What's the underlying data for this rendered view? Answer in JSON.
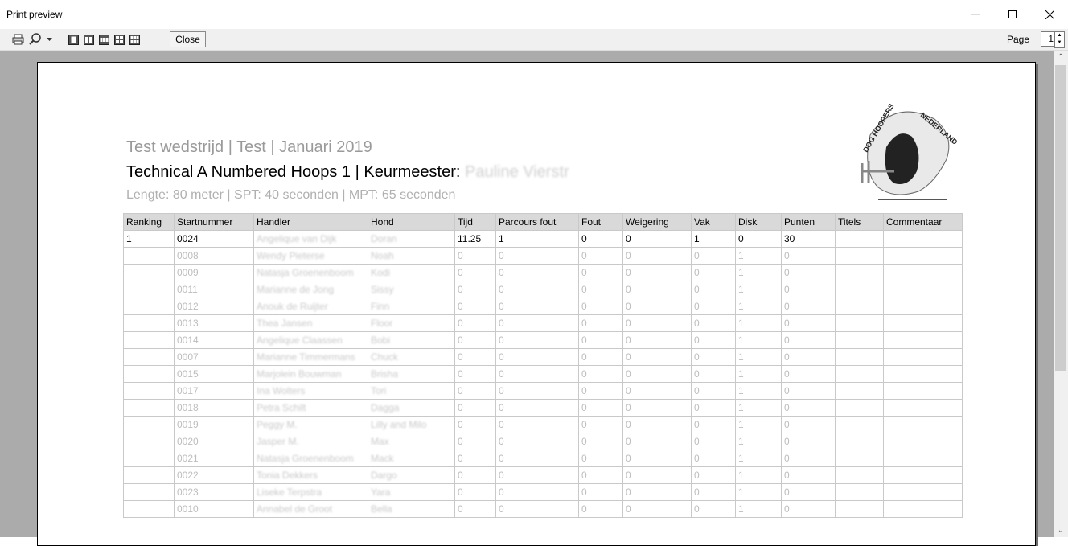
{
  "window": {
    "title": "Print preview",
    "minimize_icon": "minimize-icon",
    "maximize_icon": "maximize-icon",
    "close_icon": "close-icon"
  },
  "toolbar": {
    "close_label": "Close",
    "page_label": "Page",
    "page_value": "1",
    "icons": [
      "print-icon",
      "zoom-icon",
      "chevron-down-icon",
      "one-page-icon",
      "two-pages-icon",
      "three-pages-icon",
      "four-pages-icon",
      "six-pages-icon"
    ]
  },
  "report": {
    "heading_line1": "Test wedstrijd  |  Test  |  Januari 2019",
    "heading_line2": "Technical A Numbered Hoops 1  |  Keurmeester:",
    "judge_name": "Pauline Vierstr",
    "heading_line3": "Lengte: 80 meter  |  SPT: 40 seconden  |  MPT: 65 seconden",
    "logo_text_left": "DOG HOOPERS",
    "logo_text_right": "NEDERLAND",
    "columns": [
      "Ranking",
      "Startnummer",
      "Handler",
      "Hond",
      "Tijd",
      "Parcours fout",
      "Fout",
      "Weigering",
      "Vak",
      "Disk",
      "Punten",
      "Titels",
      "Commentaar"
    ],
    "rows": [
      {
        "ranking": "1",
        "startnummer": "0024",
        "handler": "Angelique van Dijk",
        "hond": "Doran",
        "tijd": "11.25",
        "parcours_fout": "1",
        "fout": "0",
        "weigering": "0",
        "vak": "1",
        "disk": "0",
        "punten": "30",
        "titels": "",
        "commentaar": ""
      },
      {
        "ranking": "",
        "startnummer": "0008",
        "handler": "Wendy Pieterse",
        "hond": "Noah",
        "tijd": "0",
        "parcours_fout": "0",
        "fout": "0",
        "weigering": "0",
        "vak": "0",
        "disk": "1",
        "punten": "0",
        "titels": "",
        "commentaar": ""
      },
      {
        "ranking": "",
        "startnummer": "0009",
        "handler": "Natasja Groenenboom",
        "hond": "Kodi",
        "tijd": "0",
        "parcours_fout": "0",
        "fout": "0",
        "weigering": "0",
        "vak": "0",
        "disk": "1",
        "punten": "0",
        "titels": "",
        "commentaar": ""
      },
      {
        "ranking": "",
        "startnummer": "0011",
        "handler": "Marianne de Jong",
        "hond": "Sissy",
        "tijd": "0",
        "parcours_fout": "0",
        "fout": "0",
        "weigering": "0",
        "vak": "0",
        "disk": "1",
        "punten": "0",
        "titels": "",
        "commentaar": ""
      },
      {
        "ranking": "",
        "startnummer": "0012",
        "handler": "Anouk de Ruijter",
        "hond": "Finn",
        "tijd": "0",
        "parcours_fout": "0",
        "fout": "0",
        "weigering": "0",
        "vak": "0",
        "disk": "1",
        "punten": "0",
        "titels": "",
        "commentaar": ""
      },
      {
        "ranking": "",
        "startnummer": "0013",
        "handler": "Thea Jansen",
        "hond": "Floor",
        "tijd": "0",
        "parcours_fout": "0",
        "fout": "0",
        "weigering": "0",
        "vak": "0",
        "disk": "1",
        "punten": "0",
        "titels": "",
        "commentaar": ""
      },
      {
        "ranking": "",
        "startnummer": "0014",
        "handler": "Angelique Claassen",
        "hond": "Bobi",
        "tijd": "0",
        "parcours_fout": "0",
        "fout": "0",
        "weigering": "0",
        "vak": "0",
        "disk": "1",
        "punten": "0",
        "titels": "",
        "commentaar": ""
      },
      {
        "ranking": "",
        "startnummer": "0007",
        "handler": "Marianne Timmermans",
        "hond": "Chuck",
        "tijd": "0",
        "parcours_fout": "0",
        "fout": "0",
        "weigering": "0",
        "vak": "0",
        "disk": "1",
        "punten": "0",
        "titels": "",
        "commentaar": ""
      },
      {
        "ranking": "",
        "startnummer": "0015",
        "handler": "Marjolein Bouwman",
        "hond": "Brisha",
        "tijd": "0",
        "parcours_fout": "0",
        "fout": "0",
        "weigering": "0",
        "vak": "0",
        "disk": "1",
        "punten": "0",
        "titels": "",
        "commentaar": ""
      },
      {
        "ranking": "",
        "startnummer": "0017",
        "handler": "Ina Wolters",
        "hond": "Tori",
        "tijd": "0",
        "parcours_fout": "0",
        "fout": "0",
        "weigering": "0",
        "vak": "0",
        "disk": "1",
        "punten": "0",
        "titels": "",
        "commentaar": ""
      },
      {
        "ranking": "",
        "startnummer": "0018",
        "handler": "Petra Schilt",
        "hond": "Dagga",
        "tijd": "0",
        "parcours_fout": "0",
        "fout": "0",
        "weigering": "0",
        "vak": "0",
        "disk": "1",
        "punten": "0",
        "titels": "",
        "commentaar": ""
      },
      {
        "ranking": "",
        "startnummer": "0019",
        "handler": "Peggy M.",
        "hond": "Lilly and Milo",
        "tijd": "0",
        "parcours_fout": "0",
        "fout": "0",
        "weigering": "0",
        "vak": "0",
        "disk": "1",
        "punten": "0",
        "titels": "",
        "commentaar": ""
      },
      {
        "ranking": "",
        "startnummer": "0020",
        "handler": "Jasper M.",
        "hond": "Max",
        "tijd": "0",
        "parcours_fout": "0",
        "fout": "0",
        "weigering": "0",
        "vak": "0",
        "disk": "1",
        "punten": "0",
        "titels": "",
        "commentaar": ""
      },
      {
        "ranking": "",
        "startnummer": "0021",
        "handler": "Natasja Groenenboom",
        "hond": "Mack",
        "tijd": "0",
        "parcours_fout": "0",
        "fout": "0",
        "weigering": "0",
        "vak": "0",
        "disk": "1",
        "punten": "0",
        "titels": "",
        "commentaar": ""
      },
      {
        "ranking": "",
        "startnummer": "0022",
        "handler": "Tonia Dekkers",
        "hond": "Dargo",
        "tijd": "0",
        "parcours_fout": "0",
        "fout": "0",
        "weigering": "0",
        "vak": "0",
        "disk": "1",
        "punten": "0",
        "titels": "",
        "commentaar": ""
      },
      {
        "ranking": "",
        "startnummer": "0023",
        "handler": "Liseke Terpstra",
        "hond": "Yara",
        "tijd": "0",
        "parcours_fout": "0",
        "fout": "0",
        "weigering": "0",
        "vak": "0",
        "disk": "1",
        "punten": "0",
        "titels": "",
        "commentaar": ""
      },
      {
        "ranking": "",
        "startnummer": "0010",
        "handler": "Annabel de Groot",
        "hond": "Bella",
        "tijd": "0",
        "parcours_fout": "0",
        "fout": "0",
        "weigering": "0",
        "vak": "0",
        "disk": "1",
        "punten": "0",
        "titels": "",
        "commentaar": ""
      }
    ]
  },
  "colors": {
    "workspace": "#ababab",
    "header_fill": "#d9d9d9",
    "dim_text": "#bdbdbd"
  }
}
